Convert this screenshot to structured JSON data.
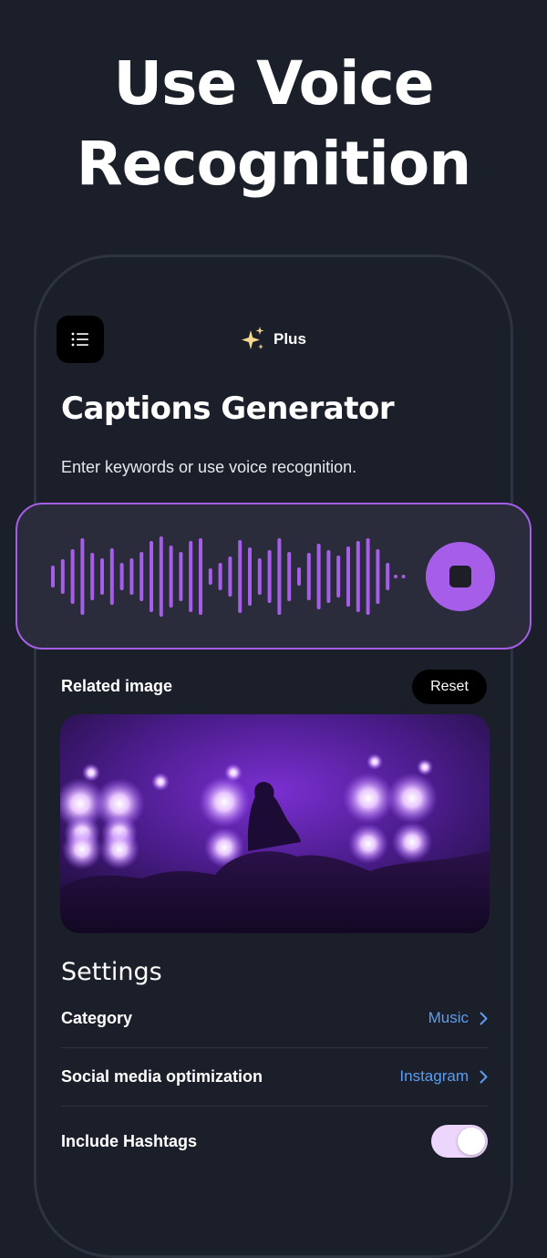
{
  "hero": {
    "line1": "Use Voice",
    "line2": "Recognition"
  },
  "header": {
    "menu_icon": "list-icon",
    "plus_icon": "sparkles-icon",
    "plus_label": "Plus"
  },
  "main": {
    "title": "Captions Generator",
    "subtitle": "Enter keywords or use voice recognition.",
    "voice": {
      "state_icon": "stop-icon",
      "accent": "#a65ee8"
    },
    "related": {
      "label": "Related image",
      "reset_label": "Reset"
    }
  },
  "settings": {
    "title": "Settings",
    "category": {
      "label": "Category",
      "value": "Music"
    },
    "social": {
      "label": "Social media optimization",
      "value": "Instagram"
    },
    "hashtags": {
      "label": "Include Hashtags",
      "enabled": true
    }
  },
  "colors": {
    "background": "#1b1f29",
    "accent": "#a65ee8",
    "link": "#5b9df5"
  }
}
